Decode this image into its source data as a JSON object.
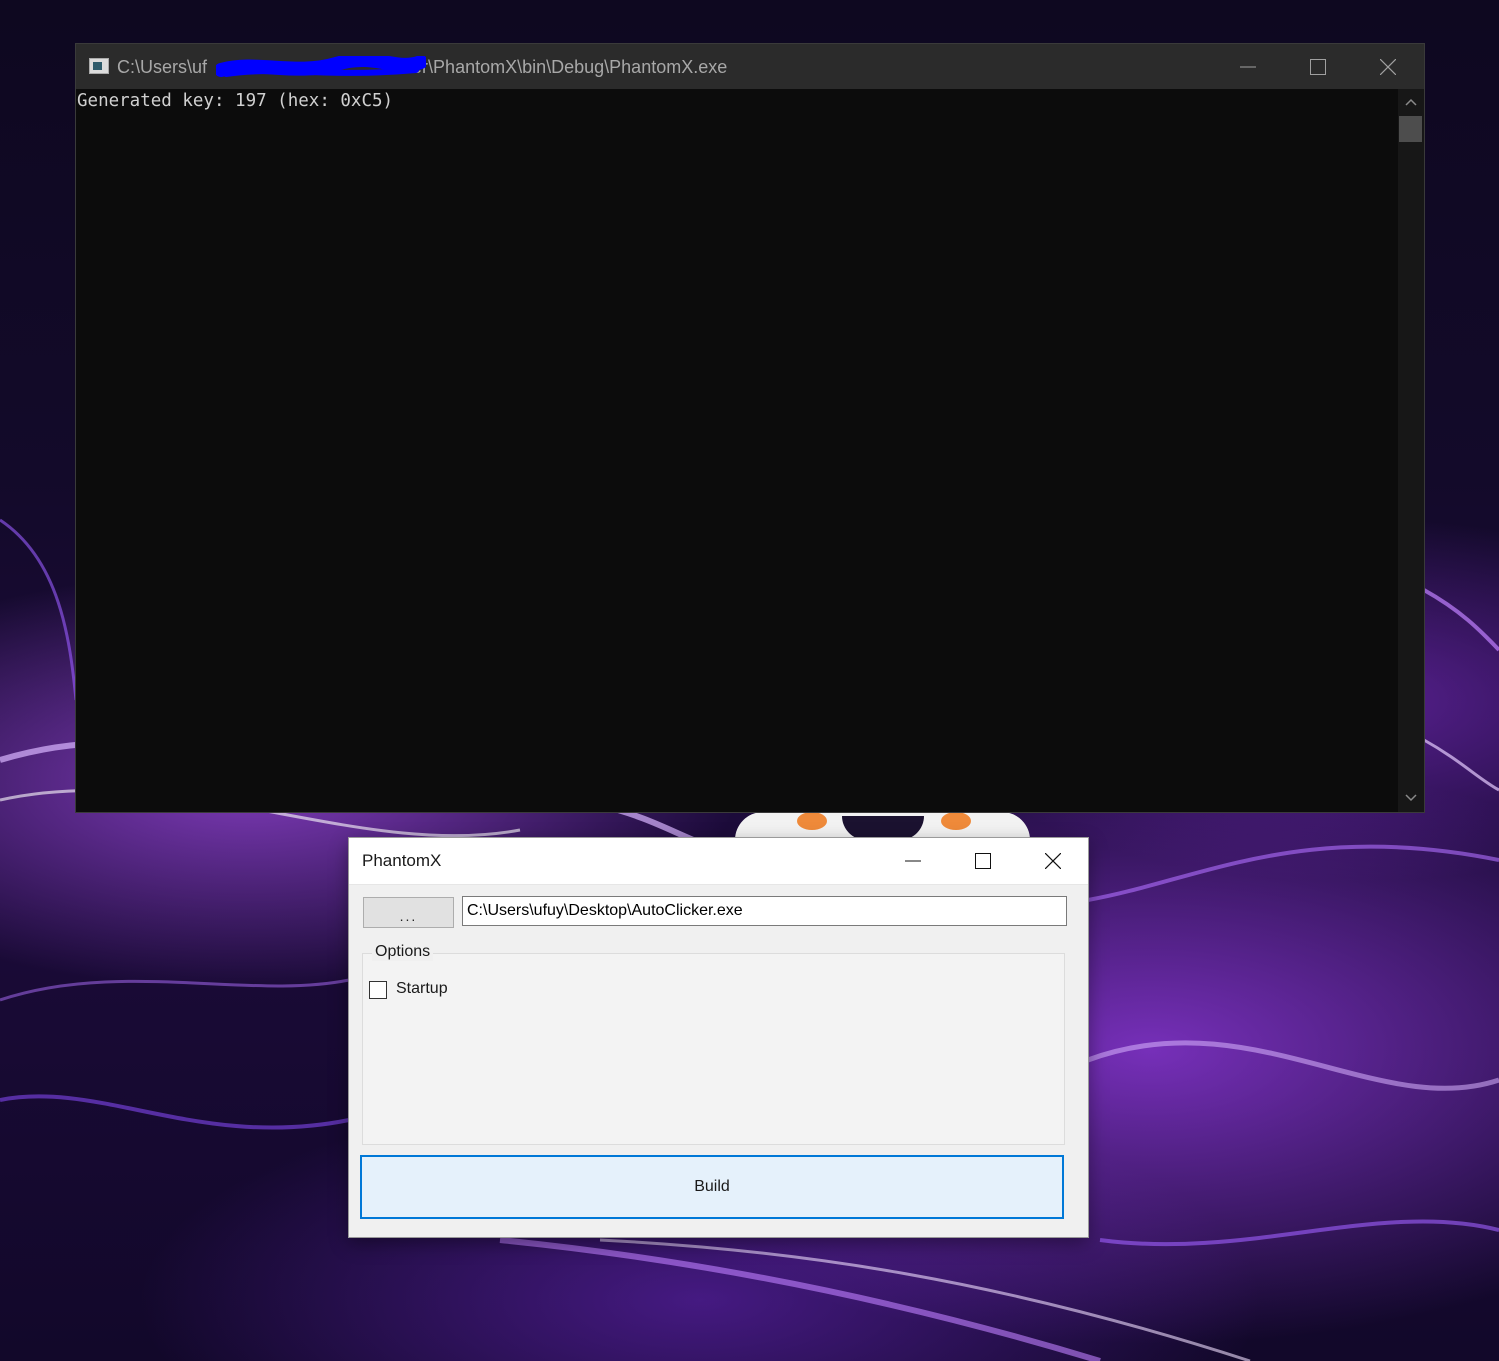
{
  "console_window": {
    "title_prefix": "C:\\Users\\uf",
    "title_suffix": "lder\\PhantomX\\bin\\Debug\\PhantomX.exe",
    "output_line": "Generated key: 197 (hex: 0xC5)"
  },
  "form_window": {
    "title": "PhantomX",
    "browse_label": "...",
    "path_value": "C:\\Users\\ufuy\\Desktop\\AutoClicker.exe",
    "options_label": "Options",
    "startup_label": "Startup",
    "startup_checked": false,
    "build_label": "Build"
  },
  "colors": {
    "accent": "#0078d7",
    "redaction": "#0000ff",
    "console_bg": "#0c0c0c"
  }
}
